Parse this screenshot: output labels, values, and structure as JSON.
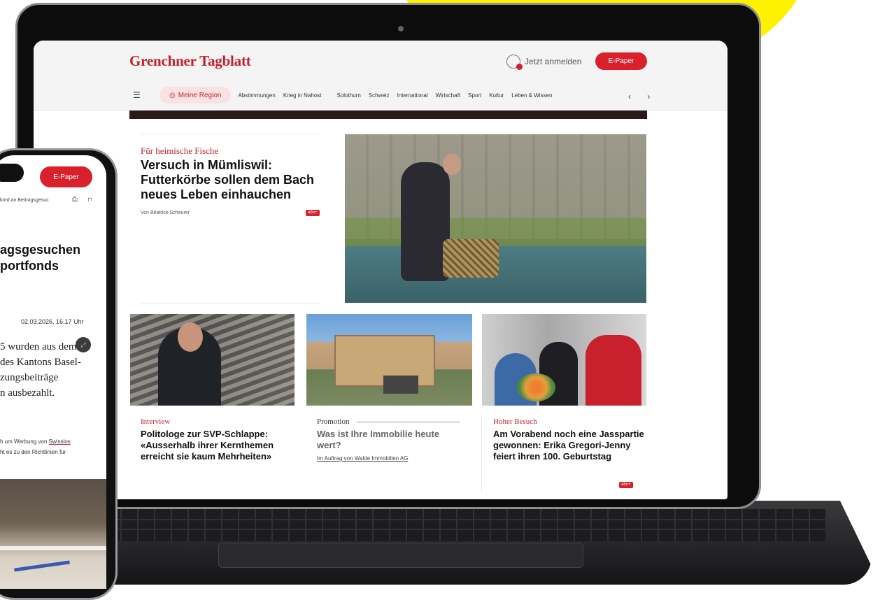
{
  "site": {
    "logo": "Grenchner Tagblatt",
    "login_label": "Jetzt anmelden",
    "epaper_label": "E-Paper",
    "accent_color": "#d9202c"
  },
  "nav": {
    "menu_icon": "menu-search-icon",
    "region_label": "Meine Region",
    "items": [
      "Abstimmungen",
      "Krieg in Nahost",
      "Solothurn",
      "Schweiz",
      "International",
      "Wirtschaft",
      "Sport",
      "Kultur",
      "Leben & Wissen"
    ],
    "arrows": "‹ ›"
  },
  "lead": {
    "kicker": "Für heimische Fische",
    "title": "Versuch in Mümliswil: Futterkörbe sollen dem Bach neues Leben einhauchen",
    "author": "Von Béatrice Scheurer",
    "badge": "abo+"
  },
  "cards": [
    {
      "kicker": "Interview",
      "title": "Politologe zur SVP-Schlappe: «Ausserhalb ihrer Kernthemen erreicht sie kaum Mehrheiten»"
    },
    {
      "kicker": "Promotion",
      "title": "Was ist Ihre Immobilie heute wert?",
      "link": "Im Auftrag von Walde Immobilien AG"
    },
    {
      "kicker": "Hoher Besuch",
      "title": "Am Vorabend noch eine Jasspartie gewonnen: Erika Gregori-Jenny feiert ihren 100. Geburtstag",
      "badge": "abo+"
    }
  ],
  "phone": {
    "epaper_label": "E-Paper",
    "breadcrumb": "kord an Beitragsgesuc",
    "share_icons": "⎙ ⊓",
    "headline_line1": "agsgesuchen",
    "headline_line2": "portfonds",
    "date": "02.03.2026, 16.17 Uhr",
    "lead_lines": [
      "5 wurden aus dem",
      "des Kantons Basel-",
      "zungsbeiträge",
      "n ausbezahlt."
    ],
    "note_line1_pre": "h um Werbung von ",
    "note_line1_link": "Swisslos",
    "note_line2": "ht es zu den Richtlinien für",
    "expand_icon": "⤢"
  }
}
